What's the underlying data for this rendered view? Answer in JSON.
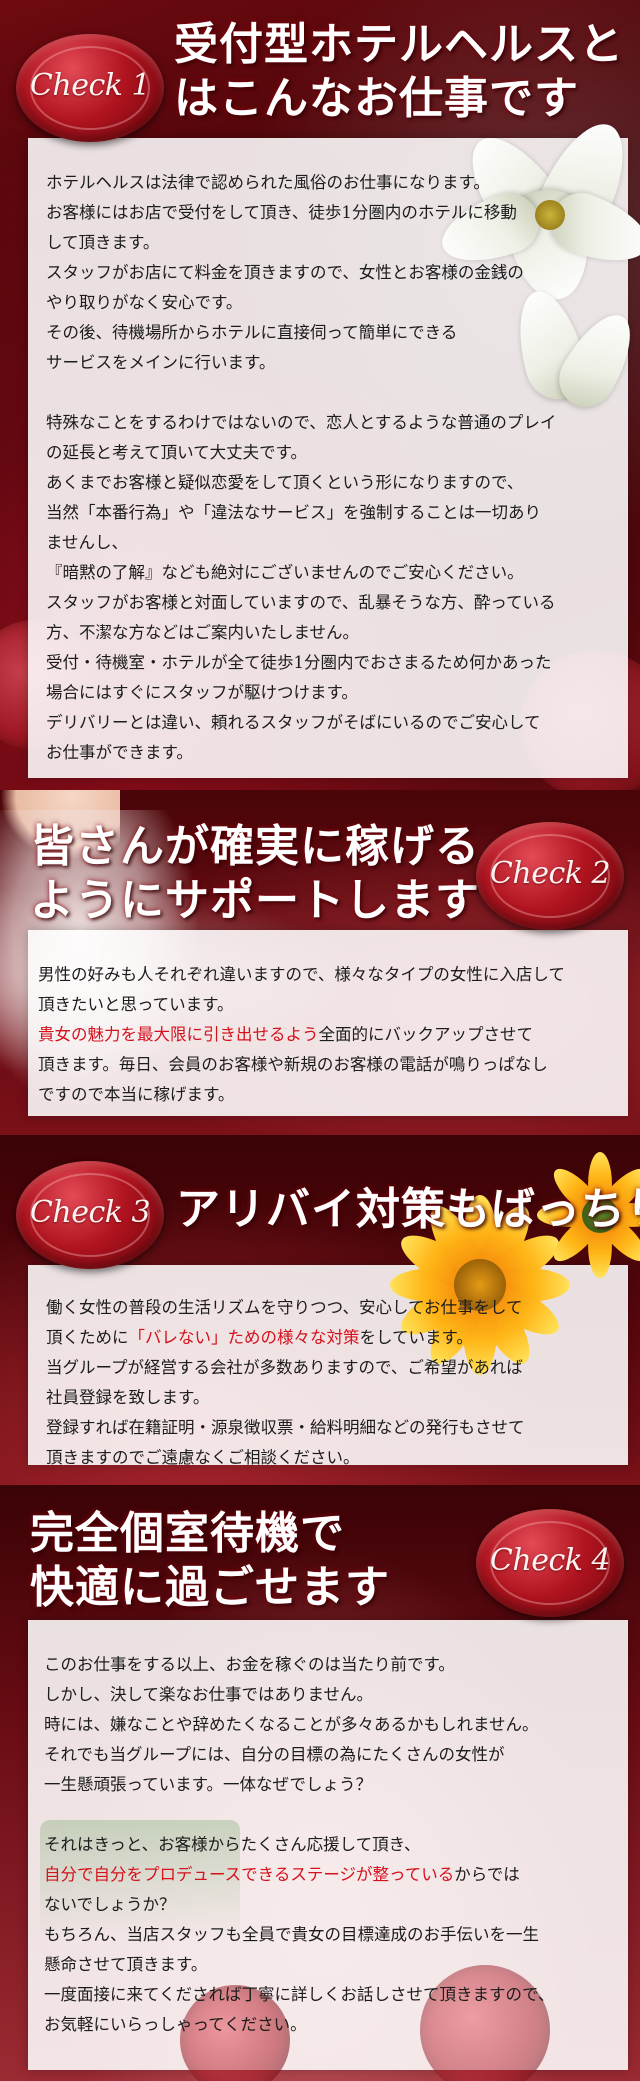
{
  "sections": [
    {
      "badge": "Check 1",
      "heading_lines": [
        "受付型ホテルヘルスと",
        "はこんなお仕事です"
      ],
      "lines": [
        "ホテルヘルスは法律で認められた風俗のお仕事になります。",
        "お客様にはお店で受付をして頂き、徒歩1分圏内のホテルに移動",
        "して頂きます。",
        "スタッフがお店にて料金を頂きますので、女性とお客様の金銭の",
        "やり取りがなく安心です。",
        "その後、待機場所からホテルに直接伺って簡単にできる",
        "サービスをメインに行います。",
        "",
        "特殊なことをするわけではないので、恋人とするような普通のプレイ",
        "の延長と考えて頂いて大丈夫です。",
        "あくまでお客様と疑似恋愛をして頂くという形になりますので、",
        "当然「本番行為」や「違法なサービス」を強制することは一切あり",
        "ませんし、",
        "『暗黙の了解』なども絶対にございませんのでご安心ください。",
        "スタッフがお客様と対面していますので、乱暴そうな方、酔っている",
        "方、不潔な方などはご案内いたしません。",
        "受付・待機室・ホテルが全て徒歩1分圏内でおさまるため何かあった",
        "場合にはすぐにスタッフが駆けつけます。",
        "デリバリーとは違い、頼れるスタッフがそばにいるのでご安心して",
        "お仕事ができます。"
      ]
    },
    {
      "badge": "Check 2",
      "heading_lines": [
        "皆さんが確実に稼げる",
        "ようにサポートします"
      ],
      "line1": "男性の好みも人それぞれ違いますので、様々なタイプの女性に入店して",
      "line2": "頂きたいと思っています。",
      "line3_highlight": "貴女の魅力を最大限に引き出せるよう",
      "line3_rest": "全面的にバックアップさせて",
      "line4": "頂きます。毎日、会員のお客様や新規のお客様の電話が鳴りっぱなし",
      "line5": "ですので本当に稼げます。"
    },
    {
      "badge": "Check 3",
      "heading": "アリバイ対策もばっちり",
      "line1": "働く女性の普段の生活リズムを守りつつ、安心してお仕事をして",
      "line2_pre": "頂くために",
      "line2_highlight": "「バレない」ための様々な対策",
      "line2_post": "をしています。",
      "line3": "当グループが経営する会社が多数ありますので、ご希望があれば",
      "line4": "社員登録を致します。",
      "line5": "登録すれば在籍証明・源泉徴収票・給料明細などの発行もさせて",
      "line6": "頂きますのでご遠慮なくご相談ください。"
    },
    {
      "badge": "Check 4",
      "heading_lines": [
        "完全個室待機で",
        "快適に過ごせます"
      ],
      "line1": "このお仕事をする以上、お金を稼ぐのは当たり前です。",
      "line2": "しかし、決して楽なお仕事ではありません。",
      "line3": "時には、嫌なことや辞めたくなることが多々あるかもしれません。",
      "line4": "それでも当グループには、自分の目標の為にたくさんの女性が",
      "line5": "一生懸頑張っています。一体なぜでしょう？",
      "line6": "",
      "line7": "それはきっと、お客様からたくさん応援して頂き、",
      "line8_highlight": "自分で自分をプロデュースできるステージが整っている",
      "line8_rest": "からでは",
      "line9": "ないでしょうか？",
      "line10": "もちろん、当店スタッフも全員で貴女の目標達成のお手伝いを一生",
      "line11": "懸命させて頂きます。",
      "line12": "一度面接に来てくだされば丁寧に詳しくお話しさせて頂きますので、",
      "line13": "お気軽にいらっしゃってください。"
    }
  ],
  "colors": {
    "highlight": "#d5111c",
    "seal": "#b0141f",
    "background": "#3a0306"
  }
}
